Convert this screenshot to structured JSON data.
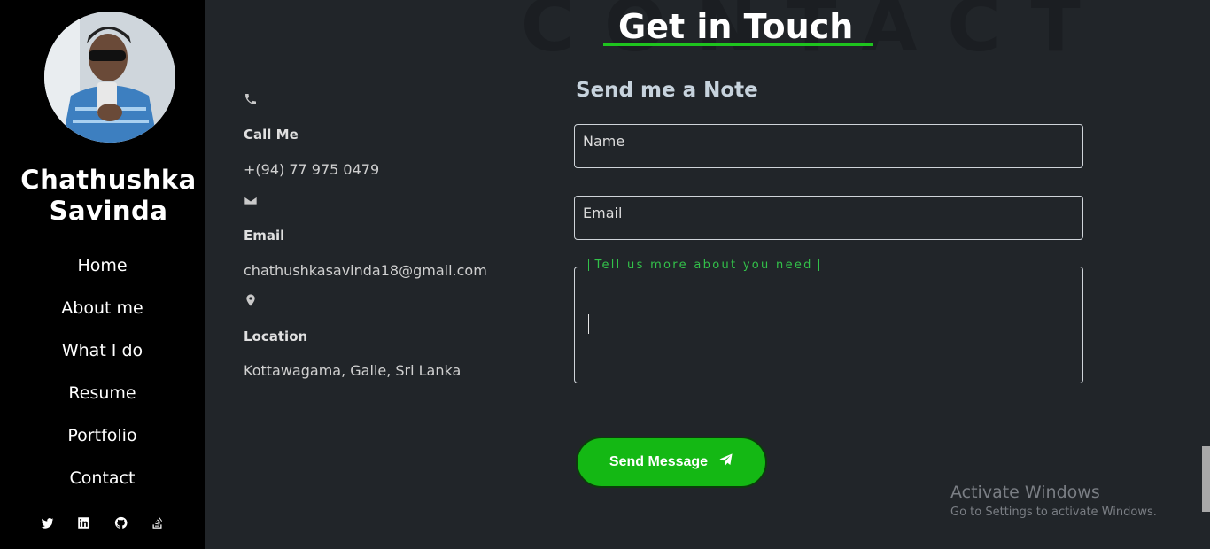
{
  "sidebar": {
    "name": "Chathushka Savinda",
    "nav": [
      "Home",
      "About me",
      "What I do",
      "Resume",
      "Portfolio",
      "Contact"
    ],
    "social_icons": [
      "twitter-icon",
      "linkedin-icon",
      "github-icon",
      "stackoverflow-icon"
    ]
  },
  "header": {
    "background_word": "CONTACT",
    "title": "Get in Touch",
    "accent_color": "#1ec41e"
  },
  "contact": {
    "phone_label": "Call Me",
    "phone_value": "+(94) 77 975 0479",
    "email_label": "Email",
    "email_value": "chathushkasavinda18@gmail.com",
    "location_label": "Location",
    "location_value": "Kottawagama, Galle, Sri Lanka"
  },
  "form": {
    "heading": "Send me a Note",
    "name_placeholder": "Name",
    "email_placeholder": "Email",
    "message_legend": "Tell us more about you need",
    "send_label": "Send Message"
  },
  "watermark": {
    "title": "Activate Windows",
    "subtitle": "Go to Settings to activate Windows."
  }
}
